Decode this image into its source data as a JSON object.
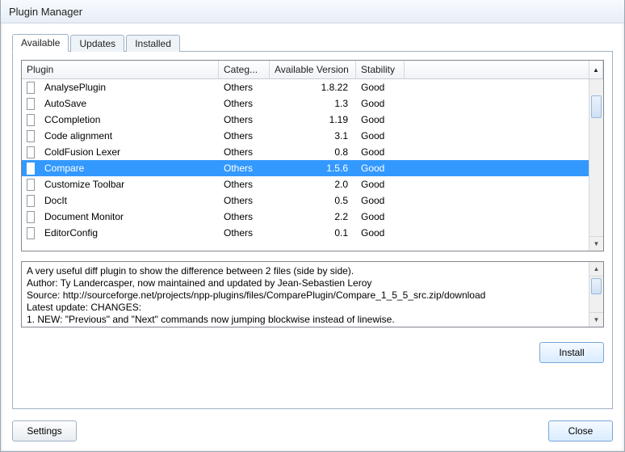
{
  "window": {
    "title": "Plugin Manager"
  },
  "tabs": [
    {
      "label": "Available",
      "active": true
    },
    {
      "label": "Updates",
      "active": false
    },
    {
      "label": "Installed",
      "active": false
    }
  ],
  "grid": {
    "headers": {
      "plugin": "Plugin",
      "category": "Categ...",
      "version": "Available Version",
      "stability": "Stability"
    },
    "rows": [
      {
        "checked": false,
        "name": "AnalysePlugin",
        "category": "Others",
        "version": "1.8.22",
        "stability": "Good",
        "selected": false
      },
      {
        "checked": false,
        "name": "AutoSave",
        "category": "Others",
        "version": "1.3",
        "stability": "Good",
        "selected": false
      },
      {
        "checked": false,
        "name": "CCompletion",
        "category": "Others",
        "version": "1.19",
        "stability": "Good",
        "selected": false
      },
      {
        "checked": false,
        "name": "Code alignment",
        "category": "Others",
        "version": "3.1",
        "stability": "Good",
        "selected": false
      },
      {
        "checked": false,
        "name": "ColdFusion Lexer",
        "category": "Others",
        "version": "0.8",
        "stability": "Good",
        "selected": false
      },
      {
        "checked": true,
        "name": "Compare",
        "category": "Others",
        "version": "1.5.6",
        "stability": "Good",
        "selected": true
      },
      {
        "checked": false,
        "name": "Customize Toolbar",
        "category": "Others",
        "version": "2.0",
        "stability": "Good",
        "selected": false
      },
      {
        "checked": false,
        "name": "DocIt",
        "category": "Others",
        "version": "0.5",
        "stability": "Good",
        "selected": false
      },
      {
        "checked": false,
        "name": "Document Monitor",
        "category": "Others",
        "version": "2.2",
        "stability": "Good",
        "selected": false
      },
      {
        "checked": false,
        "name": "EditorConfig",
        "category": "Others",
        "version": "0.1",
        "stability": "Good",
        "selected": false
      }
    ]
  },
  "description": {
    "line1": "A very useful diff plugin to show the difference between 2 files (side by side).",
    "line2": "Author: Ty Landercasper, now maintained and updated by Jean-Sebastien Leroy",
    "line3": "Source: http://sourceforge.net/projects/npp-plugins/files/ComparePlugin/Compare_1_5_5_src.zip/download",
    "line4": "Latest update: CHANGES:",
    "line5": "1. NEW: \"Previous\" and \"Next\" commands now jumping blockwise instead of linewise."
  },
  "buttons": {
    "install": "Install",
    "settings": "Settings",
    "close": "Close"
  }
}
